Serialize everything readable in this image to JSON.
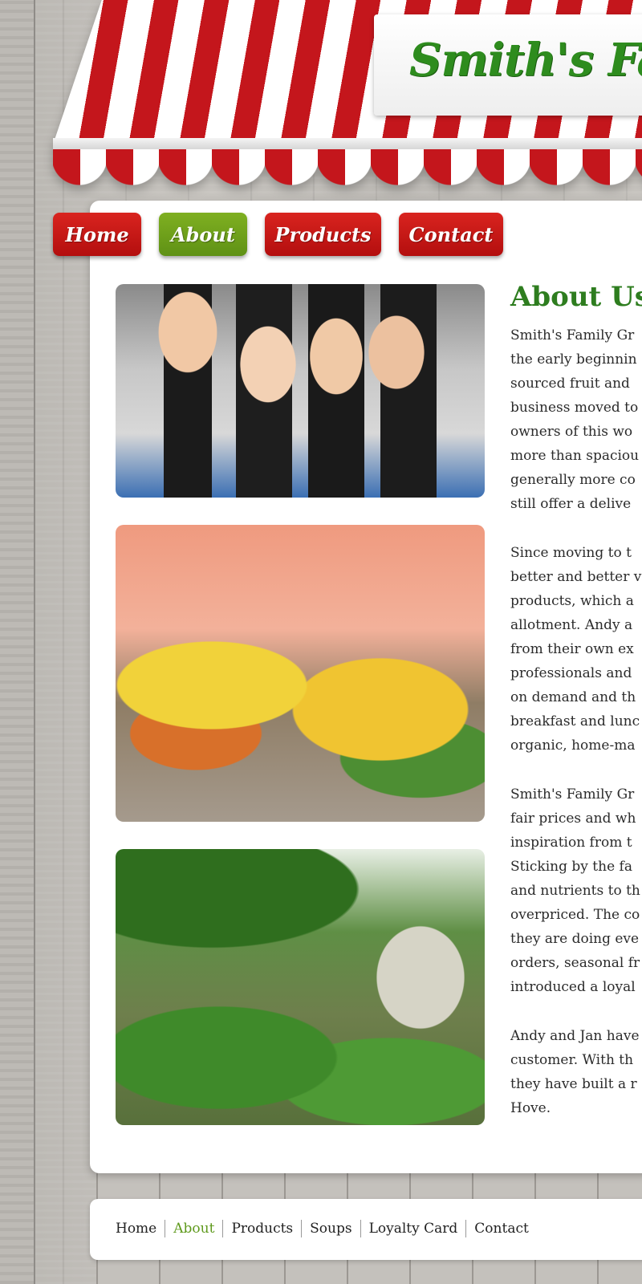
{
  "site": {
    "title": "Smith's Family"
  },
  "nav": {
    "items": [
      {
        "label": "Home",
        "active": false
      },
      {
        "label": "About",
        "active": true
      },
      {
        "label": "Products",
        "active": false
      },
      {
        "label": "Contact",
        "active": false
      }
    ]
  },
  "content": {
    "heading": "About Us",
    "paragraphs": [
      [
        "Smith's Family Gr",
        "the early beginnin",
        "sourced fruit and",
        "business moved to",
        "owners of this wo",
        "more than spaciou",
        "generally more co",
        "still offer a delive"
      ],
      [
        "Since moving to t",
        "better and better v",
        "products, which a",
        "allotment. Andy a",
        "from their own ex",
        "professionals and",
        "on demand and th",
        "breakfast and lunc",
        "organic, home-ma"
      ],
      [
        "Smith's Family Gr",
        "fair prices and wh",
        "inspiration from t",
        "Sticking by the fa",
        "and nutrients to th",
        "overpriced. The co",
        "they are doing eve",
        "orders, seasonal fr",
        "introduced a loyal"
      ],
      [
        "Andy and Jan have",
        "customer. With th",
        "they have built a r",
        "Hove."
      ]
    ]
  },
  "footer": {
    "links": [
      {
        "label": "Home",
        "active": false
      },
      {
        "label": "About",
        "active": true
      },
      {
        "label": "Products",
        "active": false
      },
      {
        "label": "Soups",
        "active": false
      },
      {
        "label": "Loyalty Card",
        "active": false
      },
      {
        "label": "Contact",
        "active": false
      }
    ]
  },
  "colors": {
    "brand_red": "#c4161c",
    "brand_green": "#2e7d1f",
    "active_green": "#6ea31b"
  }
}
